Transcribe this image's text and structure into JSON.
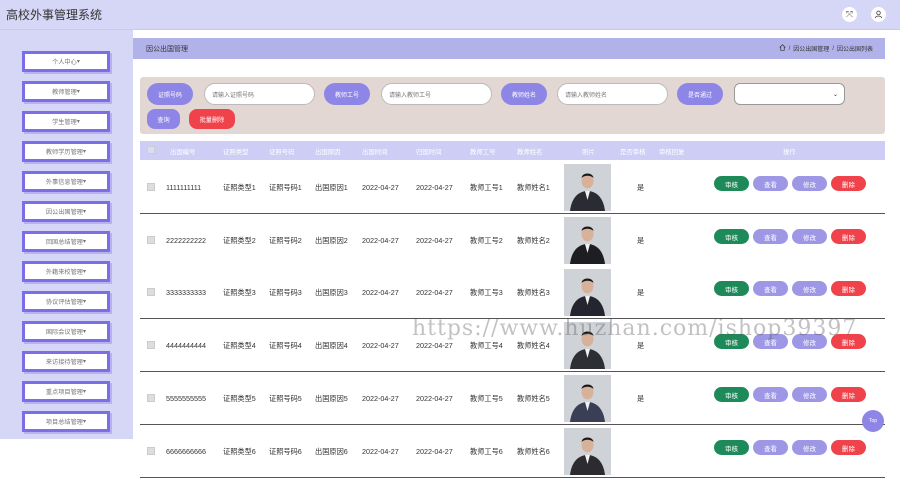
{
  "app": {
    "title": "高校外事管理系统"
  },
  "top_icons": [
    "fullscreen-icon",
    "user-icon"
  ],
  "sidebar": {
    "items": [
      "个人中心",
      "教师管理",
      "学生管理",
      "教师学历管理",
      "外事信息管理",
      "因公出国管理",
      "回国总结管理",
      "外籍来校管理",
      "协议评估管理",
      "国际会议管理",
      "来访接待管理",
      "重点项目管理",
      "项目总结管理"
    ]
  },
  "breadcrumb": {
    "title": "因公出国管理",
    "path": [
      "因公出国管理",
      "因公出国列表"
    ]
  },
  "filters": {
    "cert_label": "证照号码",
    "cert_placeholder": "请输入证照号码",
    "teacher_no_label": "教师工号",
    "teacher_no_placeholder": "请输入教师工号",
    "teacher_name_label": "教师姓名",
    "teacher_name_placeholder": "请输入教师姓名",
    "passed_label": "是否通过",
    "passed_value": "",
    "search_button": "查询",
    "batch_delete_button": "批量删除"
  },
  "table": {
    "columns": [
      "出国编号",
      "证照类型",
      "证照号码",
      "出国原因",
      "出国时间",
      "归国时间",
      "教师工号",
      "教师姓名",
      "照片",
      "是否审核",
      "审核回复",
      "操作"
    ],
    "actions": {
      "review": "审核",
      "view": "查看",
      "edit": "修改",
      "delete": "删除"
    },
    "rows": [
      {
        "no": "1111111111",
        "cert_type": "证照类型1",
        "cert_no": "证照号码1",
        "reason": "出国原因1",
        "depart": "2022-04-27",
        "return": "2022-04-27",
        "tno": "教师工号1",
        "tname": "教师姓名1",
        "approved": "是",
        "reply": ""
      },
      {
        "no": "2222222222",
        "cert_type": "证照类型2",
        "cert_no": "证照号码2",
        "reason": "出国原因2",
        "depart": "2022-04-27",
        "return": "2022-04-27",
        "tno": "教师工号2",
        "tname": "教师姓名2",
        "approved": "是",
        "reply": ""
      },
      {
        "no": "3333333333",
        "cert_type": "证照类型3",
        "cert_no": "证照号码3",
        "reason": "出国原因3",
        "depart": "2022-04-27",
        "return": "2022-04-27",
        "tno": "教师工号3",
        "tname": "教师姓名3",
        "approved": "是",
        "reply": ""
      },
      {
        "no": "4444444444",
        "cert_type": "证照类型4",
        "cert_no": "证照号码4",
        "reason": "出国原因4",
        "depart": "2022-04-27",
        "return": "2022-04-27",
        "tno": "教师工号4",
        "tname": "教师姓名4",
        "approved": "是",
        "reply": ""
      },
      {
        "no": "5555555555",
        "cert_type": "证照类型5",
        "cert_no": "证照号码5",
        "reason": "出国原因5",
        "depart": "2022-04-27",
        "return": "2022-04-27",
        "tno": "教师工号5",
        "tname": "教师姓名5",
        "approved": "是",
        "reply": ""
      },
      {
        "no": "6666666666",
        "cert_type": "证照类型6",
        "cert_no": "证照号码6",
        "reason": "出国原因6",
        "depart": "2022-04-27",
        "return": "2022-04-27",
        "tno": "教师工号6",
        "tname": "教师姓名6",
        "approved": "",
        "reply": ""
      }
    ]
  },
  "top_button": "Top",
  "watermark": "https://www.huzhan.com/ishop39397",
  "colors": {
    "accent": "#8e86e6",
    "review": "#1e8a5a",
    "view": "#9d97e6",
    "edit": "#9d97e6",
    "delete": "#f0424a",
    "batch_delete": "#f0424a",
    "sidebar_bg": "#d6d6f7"
  }
}
